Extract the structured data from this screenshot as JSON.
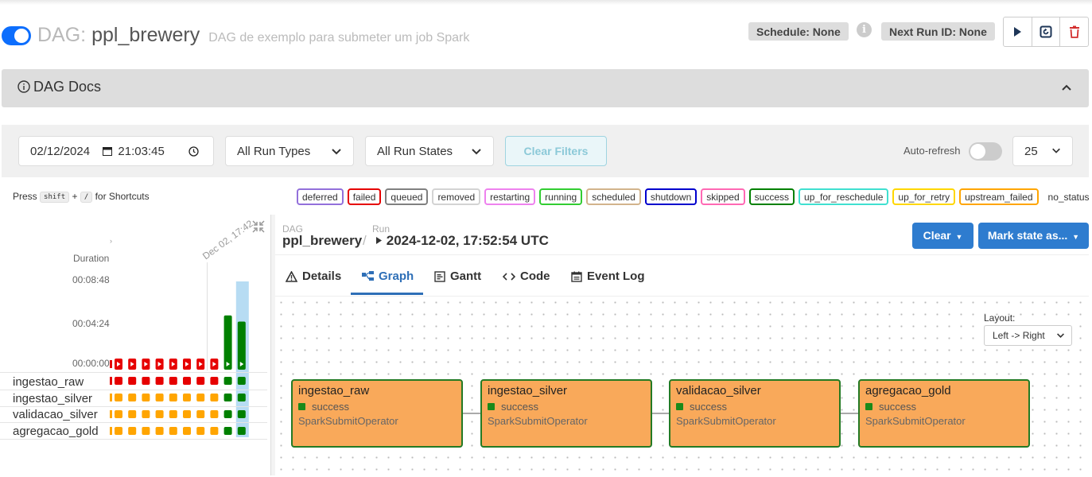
{
  "header": {
    "dag_label": "DAG:",
    "dag_id": "ppl_brewery",
    "description": "DAG de exemplo para submeter um job Spark",
    "schedule": "Schedule: None",
    "next_run": "Next Run ID: None",
    "paused_toggle_on": true
  },
  "docs": {
    "title": "DAG Docs"
  },
  "filters": {
    "date": "02/12/2024",
    "time": "21:03:45",
    "run_types": "All Run Types",
    "run_states": "All Run States",
    "clear_filters": "Clear Filters",
    "auto_refresh": "Auto-refresh",
    "page_size": "25"
  },
  "shortcuts": {
    "press": "Press",
    "key1": "shift",
    "plus": "+",
    "key2": "/",
    "suffix": "for Shortcuts"
  },
  "legend": [
    {
      "label": "deferred",
      "color": "#9370db"
    },
    {
      "label": "failed",
      "color": "#e60000"
    },
    {
      "label": "queued",
      "color": "#808080"
    },
    {
      "label": "removed",
      "color": "#d3d3d3"
    },
    {
      "label": "restarting",
      "color": "#ee82ee"
    },
    {
      "label": "running",
      "color": "#32cd32"
    },
    {
      "label": "scheduled",
      "color": "#d2b48c"
    },
    {
      "label": "shutdown",
      "color": "#0000cd"
    },
    {
      "label": "skipped",
      "color": "#ff69b4"
    },
    {
      "label": "success",
      "color": "#008000"
    },
    {
      "label": "up_for_reschedule",
      "color": "#40e0d0"
    },
    {
      "label": "up_for_retry",
      "color": "#ffd700"
    },
    {
      "label": "upstream_failed",
      "color": "#ffa500"
    },
    {
      "label": "no_status",
      "color": "transparent"
    }
  ],
  "grid": {
    "duration_label": "Duration",
    "duration_ticks": [
      "00:08:48",
      "00:04:24",
      "00:00:00"
    ],
    "date_label": "Dec 02, 17:42",
    "runs": [
      {
        "state": "failed",
        "duration": 0
      },
      {
        "state": "failed",
        "duration": 0
      },
      {
        "state": "failed",
        "duration": 0
      },
      {
        "state": "failed",
        "duration": 0
      },
      {
        "state": "failed",
        "duration": 0
      },
      {
        "state": "failed",
        "duration": 0
      },
      {
        "state": "failed",
        "duration": 0
      },
      {
        "state": "failed",
        "duration": 0
      },
      {
        "state": "success",
        "duration": 0.62
      },
      {
        "state": "success",
        "duration": 0.55,
        "selected": true
      }
    ],
    "tasks": [
      {
        "label": "ingestao_raw",
        "states": [
          "failed",
          "failed",
          "failed",
          "failed",
          "failed",
          "failed",
          "failed",
          "failed",
          "success",
          "success"
        ]
      },
      {
        "label": "ingestao_silver",
        "states": [
          "upstream_failed",
          "upstream_failed",
          "upstream_failed",
          "upstream_failed",
          "upstream_failed",
          "upstream_failed",
          "upstream_failed",
          "upstream_failed",
          "success",
          "success"
        ]
      },
      {
        "label": "validacao_silver",
        "states": [
          "upstream_failed",
          "upstream_failed",
          "upstream_failed",
          "upstream_failed",
          "upstream_failed",
          "upstream_failed",
          "upstream_failed",
          "upstream_failed",
          "success",
          "success"
        ]
      },
      {
        "label": "agregacao_gold",
        "states": [
          "upstream_failed",
          "upstream_failed",
          "upstream_failed",
          "upstream_failed",
          "upstream_failed",
          "upstream_failed",
          "upstream_failed",
          "upstream_failed",
          "success",
          "success"
        ]
      }
    ]
  },
  "breadcrumb": {
    "dag_small": "DAG",
    "dag_name": "ppl_brewery",
    "sep": "/",
    "run_small": "Run",
    "run_name": "2024-12-02, 17:52:54 UTC"
  },
  "actions": {
    "clear": "Clear",
    "mark_state": "Mark state as..."
  },
  "tabs": [
    {
      "label": "Details",
      "active": false
    },
    {
      "label": "Graph",
      "active": true
    },
    {
      "label": "Gantt",
      "active": false
    },
    {
      "label": "Code",
      "active": false
    },
    {
      "label": "Event Log",
      "active": false
    }
  ],
  "graph": {
    "layout_label": "Layout:",
    "layout_value": "Left -> Right",
    "nodes": [
      {
        "name": "ingestao_raw",
        "state": "success",
        "operator": "SparkSubmitOperator"
      },
      {
        "name": "ingestao_silver",
        "state": "success",
        "operator": "SparkSubmitOperator"
      },
      {
        "name": "validacao_silver",
        "state": "success",
        "operator": "SparkSubmitOperator"
      },
      {
        "name": "agregacao_gold",
        "state": "success",
        "operator": "SparkSubmitOperator"
      }
    ]
  }
}
